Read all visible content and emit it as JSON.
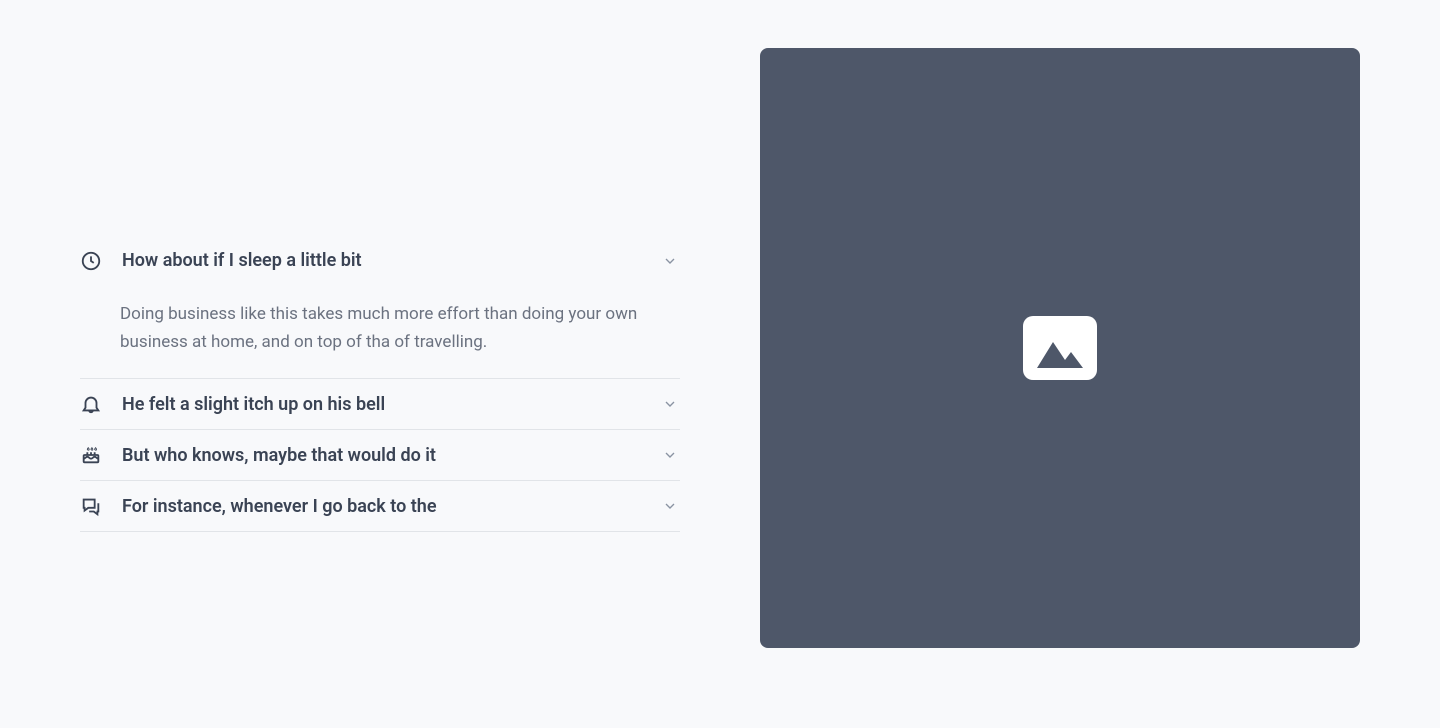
{
  "accordion": {
    "items": [
      {
        "icon": "clock-icon",
        "title": "How about if I sleep a little bit",
        "body": "Doing business like this takes much more effort than doing your own business at home, and on top of tha of travelling.",
        "expanded": true
      },
      {
        "icon": "bell-icon",
        "title": "He felt a slight itch up on his bell",
        "body": "",
        "expanded": false
      },
      {
        "icon": "cake-icon",
        "title": "But who knows, maybe that would do it",
        "body": "",
        "expanded": false
      },
      {
        "icon": "chat-icon",
        "title": "For instance, whenever I go back to the",
        "body": "",
        "expanded": false
      }
    ]
  },
  "colors": {
    "background": "#f8f9fb",
    "panel": "#4e5769",
    "text_primary": "#3a4354",
    "text_secondary": "#6b7280",
    "border": "#e1e4e8"
  }
}
